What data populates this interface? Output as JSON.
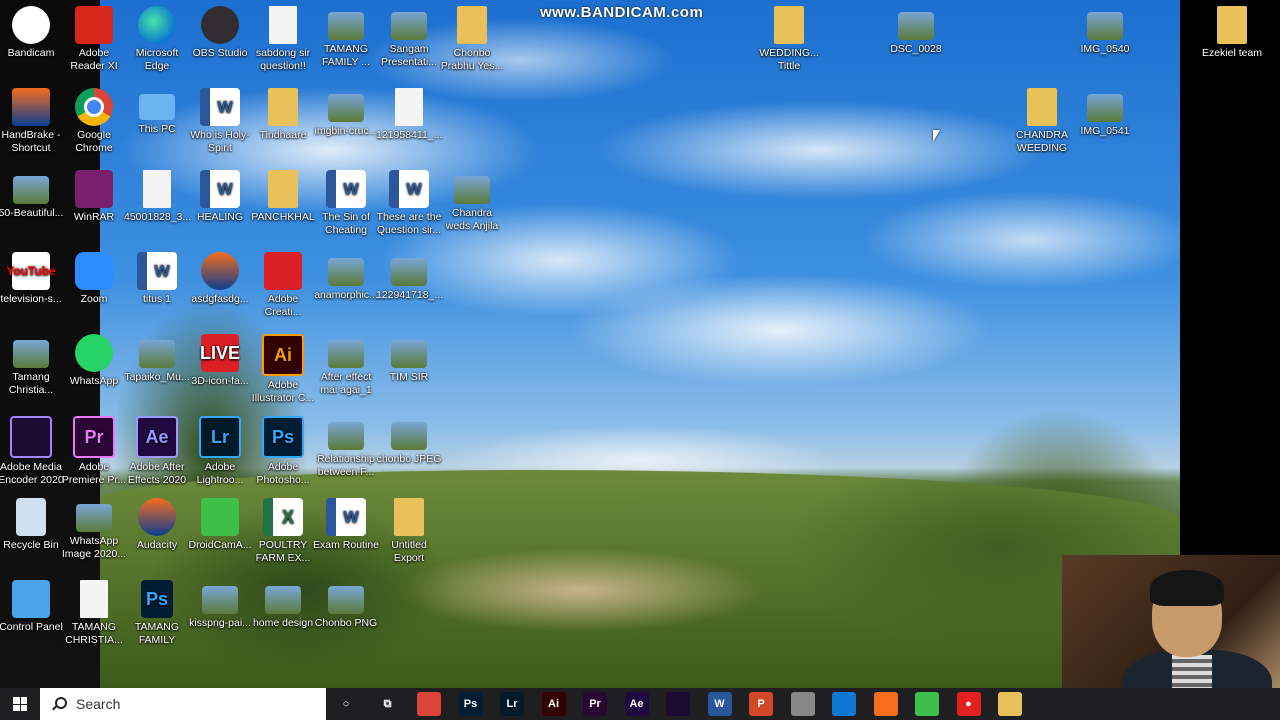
{
  "watermark": "www.BANDICAM.com",
  "desktop_icons": [
    {
      "label": "Bandicam",
      "glyph": "",
      "kind": "g-bandi round",
      "icon": "bandicam-icon"
    },
    {
      "label": "Adobe Reader XI",
      "glyph": "",
      "kind": "g-pdf",
      "icon": "adobe-reader-icon"
    },
    {
      "label": "Microsoft Edge",
      "glyph": "",
      "kind": "g-edge round",
      "icon": "edge-icon"
    },
    {
      "label": "OBS Studio",
      "glyph": "",
      "kind": "g-obs round",
      "icon": "obs-icon"
    },
    {
      "label": "sabdong sir question!!",
      "glyph": "",
      "kind": "g-doc",
      "icon": "document-icon"
    },
    {
      "label": "TAMANG FAMILY ...",
      "glyph": "",
      "kind": "g-img",
      "icon": "image-icon"
    },
    {
      "label": "Sangam Presentati...",
      "glyph": "",
      "kind": "g-img",
      "icon": "presentation-icon"
    },
    {
      "label": "Chonbo Prabhu Yes...",
      "glyph": "",
      "kind": "g-folder",
      "icon": "folder-icon"
    },
    {
      "label": "HandBrake - Shortcut",
      "glyph": "",
      "kind": "g-audacity",
      "icon": "handbrake-icon"
    },
    {
      "label": "Google Chrome",
      "glyph": "",
      "kind": "g-chrome round",
      "icon": "chrome-icon"
    },
    {
      "label": "This PC",
      "glyph": "",
      "kind": "g-pc",
      "icon": "computer-icon"
    },
    {
      "label": "Who is Holy-Spirit",
      "glyph": "W",
      "kind": "g-word",
      "icon": "word-doc-icon"
    },
    {
      "label": "Tindhaare",
      "glyph": "",
      "kind": "g-folder",
      "icon": "folder-icon"
    },
    {
      "label": "imgbin-cruc...",
      "glyph": "",
      "kind": "g-img",
      "icon": "image-icon"
    },
    {
      "label": "121958411_...",
      "glyph": "",
      "kind": "g-doc",
      "icon": "document-icon"
    },
    {
      "label": "50-Beautiful...",
      "glyph": "",
      "kind": "g-img",
      "icon": "image-icon"
    },
    {
      "label": "WinRAR",
      "glyph": "",
      "kind": "g-rar",
      "icon": "winrar-icon"
    },
    {
      "label": "45001828_3...",
      "glyph": "",
      "kind": "g-doc",
      "icon": "document-icon"
    },
    {
      "label": "HEALING",
      "glyph": "W",
      "kind": "g-word",
      "icon": "word-doc-icon"
    },
    {
      "label": "PANCHKHAL",
      "glyph": "",
      "kind": "g-folder",
      "icon": "folder-icon"
    },
    {
      "label": "The Sin of Cheating",
      "glyph": "W",
      "kind": "g-word",
      "icon": "word-doc-icon"
    },
    {
      "label": "These are the Question sir...",
      "glyph": "W",
      "kind": "g-word",
      "icon": "word-doc-icon"
    },
    {
      "label": "Chandra weds Anjila",
      "glyph": "",
      "kind": "g-img",
      "icon": "video-icon"
    },
    {
      "label": "television-s...",
      "glyph": "YouTube",
      "kind": "g-yt",
      "icon": "youtube-icon"
    },
    {
      "label": "Zoom",
      "glyph": "",
      "kind": "g-zoom",
      "icon": "zoom-icon"
    },
    {
      "label": "titus 1",
      "glyph": "W",
      "kind": "g-word",
      "icon": "word-doc-icon"
    },
    {
      "label": "asdgfasdg...",
      "glyph": "",
      "kind": "g-audacity round",
      "icon": "audio-icon"
    },
    {
      "label": "Adobe Creati...",
      "glyph": "",
      "kind": "g-cc",
      "icon": "creative-cloud-icon"
    },
    {
      "label": "anamorphic...",
      "glyph": "",
      "kind": "g-img",
      "icon": "image-icon"
    },
    {
      "label": "122941718_...",
      "glyph": "",
      "kind": "g-img",
      "icon": "image-icon"
    },
    {
      "label": "Tamang Christia...",
      "glyph": "",
      "kind": "g-img",
      "icon": "image-icon"
    },
    {
      "label": "WhatsApp",
      "glyph": "",
      "kind": "g-wa round",
      "icon": "whatsapp-icon"
    },
    {
      "label": "Tapaiko_Mu...",
      "glyph": "",
      "kind": "g-img",
      "icon": "video-icon"
    },
    {
      "label": "3D-icon-fa...",
      "glyph": "LIVE",
      "kind": "g-cc",
      "icon": "image-icon"
    },
    {
      "label": "Adobe Illustrator C...",
      "glyph": "Ai",
      "kind": "g-ai",
      "icon": "illustrator-icon"
    },
    {
      "label": "After effect mai agai_1",
      "glyph": "",
      "kind": "g-img",
      "icon": "image-icon"
    },
    {
      "label": "TIM SIR",
      "glyph": "",
      "kind": "g-img",
      "icon": "image-icon"
    },
    {
      "label": "Adobe Media Encoder 2020",
      "glyph": "",
      "kind": "g-me",
      "icon": "media-encoder-icon"
    },
    {
      "label": "Adobe Premiere Pr...",
      "glyph": "Pr",
      "kind": "g-pr",
      "icon": "premiere-icon"
    },
    {
      "label": "Adobe After Effects 2020",
      "glyph": "Ae",
      "kind": "g-ae",
      "icon": "after-effects-icon"
    },
    {
      "label": "Adobe Lightroo...",
      "glyph": "Lr",
      "kind": "g-lr",
      "icon": "lightroom-icon"
    },
    {
      "label": "Adobe Photosho...",
      "glyph": "Ps",
      "kind": "g-ps",
      "icon": "photoshop-icon"
    },
    {
      "label": "Relationship between F...",
      "glyph": "",
      "kind": "g-img",
      "icon": "presentation-icon"
    },
    {
      "label": "chonbo JPEG",
      "glyph": "",
      "kind": "g-img",
      "icon": "image-icon"
    },
    {
      "label": "Recycle Bin",
      "glyph": "",
      "kind": "g-bin",
      "icon": "recycle-bin-icon"
    },
    {
      "label": "WhatsApp Image 2020...",
      "glyph": "",
      "kind": "g-img",
      "icon": "image-icon"
    },
    {
      "label": "Audacity",
      "glyph": "",
      "kind": "g-audacity round",
      "icon": "audacity-icon"
    },
    {
      "label": "DroidCamA...",
      "glyph": "",
      "kind": "g-green",
      "icon": "droidcam-icon"
    },
    {
      "label": "POULTRY FARM EX...",
      "glyph": "X",
      "kind": "g-excel",
      "icon": "excel-doc-icon"
    },
    {
      "label": "Exam Routine",
      "glyph": "W",
      "kind": "g-word",
      "icon": "word-doc-icon"
    },
    {
      "label": "Untitled Export",
      "glyph": "",
      "kind": "g-folder",
      "icon": "folder-icon"
    },
    {
      "label": "Control Panel",
      "glyph": "",
      "kind": "g-cp",
      "icon": "control-panel-icon"
    },
    {
      "label": "TAMANG CHRISTIA...",
      "glyph": "",
      "kind": "g-doc",
      "icon": "document-icon"
    },
    {
      "label": "TAMANG FAMILY",
      "glyph": "Ps",
      "kind": "g-psd",
      "icon": "psd-file-icon"
    },
    {
      "label": "kisspng-pai...",
      "glyph": "",
      "kind": "g-img",
      "icon": "image-icon"
    },
    {
      "label": "home design",
      "glyph": "",
      "kind": "g-img",
      "icon": "image-icon"
    },
    {
      "label": "Chonbo PNG",
      "glyph": "",
      "kind": "g-img",
      "icon": "image-icon"
    },
    {
      "label": "WEDDING... Tittle",
      "glyph": "",
      "kind": "g-folder",
      "icon": "folder-icon"
    },
    {
      "label": "DSC_0028",
      "glyph": "",
      "kind": "g-img",
      "icon": "image-icon"
    },
    {
      "label": "IMG_0540",
      "glyph": "",
      "kind": "g-img",
      "icon": "image-icon"
    },
    {
      "label": "Ezekiel team",
      "glyph": "",
      "kind": "g-folder",
      "icon": "folder-icon"
    },
    {
      "label": "CHANDRA WEEDING",
      "glyph": "",
      "kind": "g-folder",
      "icon": "folder-icon"
    },
    {
      "label": "IMG_0541",
      "glyph": "",
      "kind": "g-img",
      "icon": "image-icon"
    }
  ],
  "taskbar": {
    "search_placeholder": "Search",
    "apps": [
      {
        "label": "",
        "glyph": "○",
        "icon": "cortana-icon",
        "color": "#1f1f22"
      },
      {
        "label": "",
        "glyph": "⧉",
        "icon": "task-view-icon",
        "color": "#1f1f22"
      },
      {
        "label": "",
        "glyph": "",
        "icon": "chrome-icon",
        "color": "#db4437"
      },
      {
        "label": "",
        "glyph": "Ps",
        "icon": "photoshop-icon",
        "color": "#001d34"
      },
      {
        "label": "",
        "glyph": "Lr",
        "icon": "lightroom-icon",
        "color": "#001a2a"
      },
      {
        "label": "",
        "glyph": "Ai",
        "icon": "illustrator-icon",
        "color": "#330000"
      },
      {
        "label": "",
        "glyph": "Pr",
        "icon": "premiere-icon",
        "color": "#2a0634"
      },
      {
        "label": "",
        "glyph": "Ae",
        "icon": "after-effects-icon",
        "color": "#1f0740"
      },
      {
        "label": "",
        "glyph": "",
        "icon": "media-encoder-icon",
        "color": "#1b0b33"
      },
      {
        "label": "",
        "glyph": "W",
        "icon": "word-icon",
        "color": "#2b579a"
      },
      {
        "label": "",
        "glyph": "P",
        "icon": "powerpoint-icon",
        "color": "#d24726"
      },
      {
        "label": "",
        "glyph": "",
        "icon": "explorer-icon",
        "color": "#888888"
      },
      {
        "label": "",
        "glyph": "",
        "icon": "edge-icon",
        "color": "#0c76d2"
      },
      {
        "label": "",
        "glyph": "",
        "icon": "audacity-icon",
        "color": "#f56d1f"
      },
      {
        "label": "",
        "glyph": "",
        "icon": "droidcam-icon",
        "color": "#3dbf4a"
      },
      {
        "label": "",
        "glyph": "●",
        "icon": "bandicam-record-icon",
        "color": "#e52020"
      },
      {
        "label": "",
        "glyph": "",
        "icon": "file-explorer-icon",
        "color": "#e8c15a"
      }
    ]
  }
}
